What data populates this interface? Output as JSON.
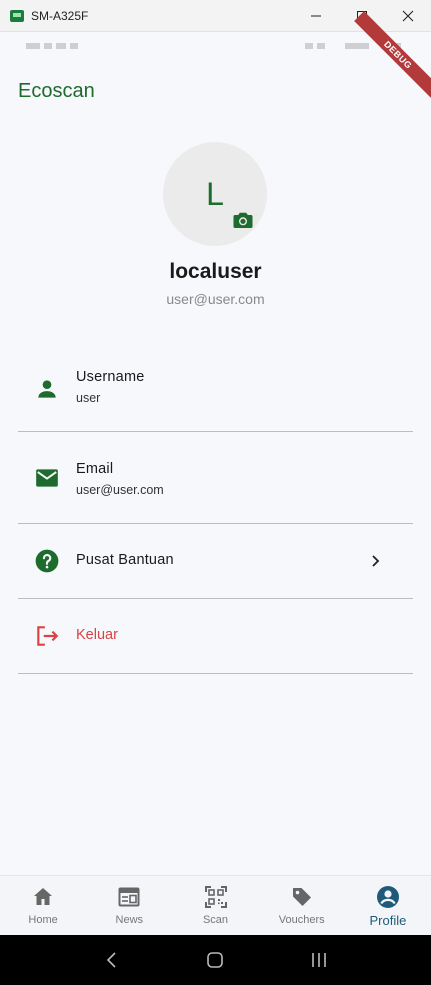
{
  "window": {
    "title": "SM-A325F"
  },
  "app": {
    "title": "Ecoscan",
    "debug_banner": "DEBUG"
  },
  "profile": {
    "avatar_letter": "L",
    "name": "localuser",
    "email": "user@user.com"
  },
  "rows": [
    {
      "label": "Username",
      "value": "user",
      "icon": "person-icon"
    },
    {
      "label": "Email",
      "value": "user@user.com",
      "icon": "mail-icon"
    },
    {
      "label": "Pusat Bantuan",
      "icon": "help-icon"
    },
    {
      "label": "Keluar",
      "icon": "logout-icon"
    }
  ],
  "nav": [
    {
      "label": "Home",
      "icon": "home-icon"
    },
    {
      "label": "News",
      "icon": "news-icon"
    },
    {
      "label": "Scan",
      "icon": "qr-scan-icon"
    },
    {
      "label": "Vouchers",
      "icon": "tag-icon"
    },
    {
      "label": "Profile",
      "icon": "account-circle-icon",
      "active": true
    }
  ],
  "colors": {
    "primary": "#1e6b2e",
    "danger": "#d84343",
    "active_nav": "#1f5a7a",
    "background": "#f7f8fc"
  }
}
